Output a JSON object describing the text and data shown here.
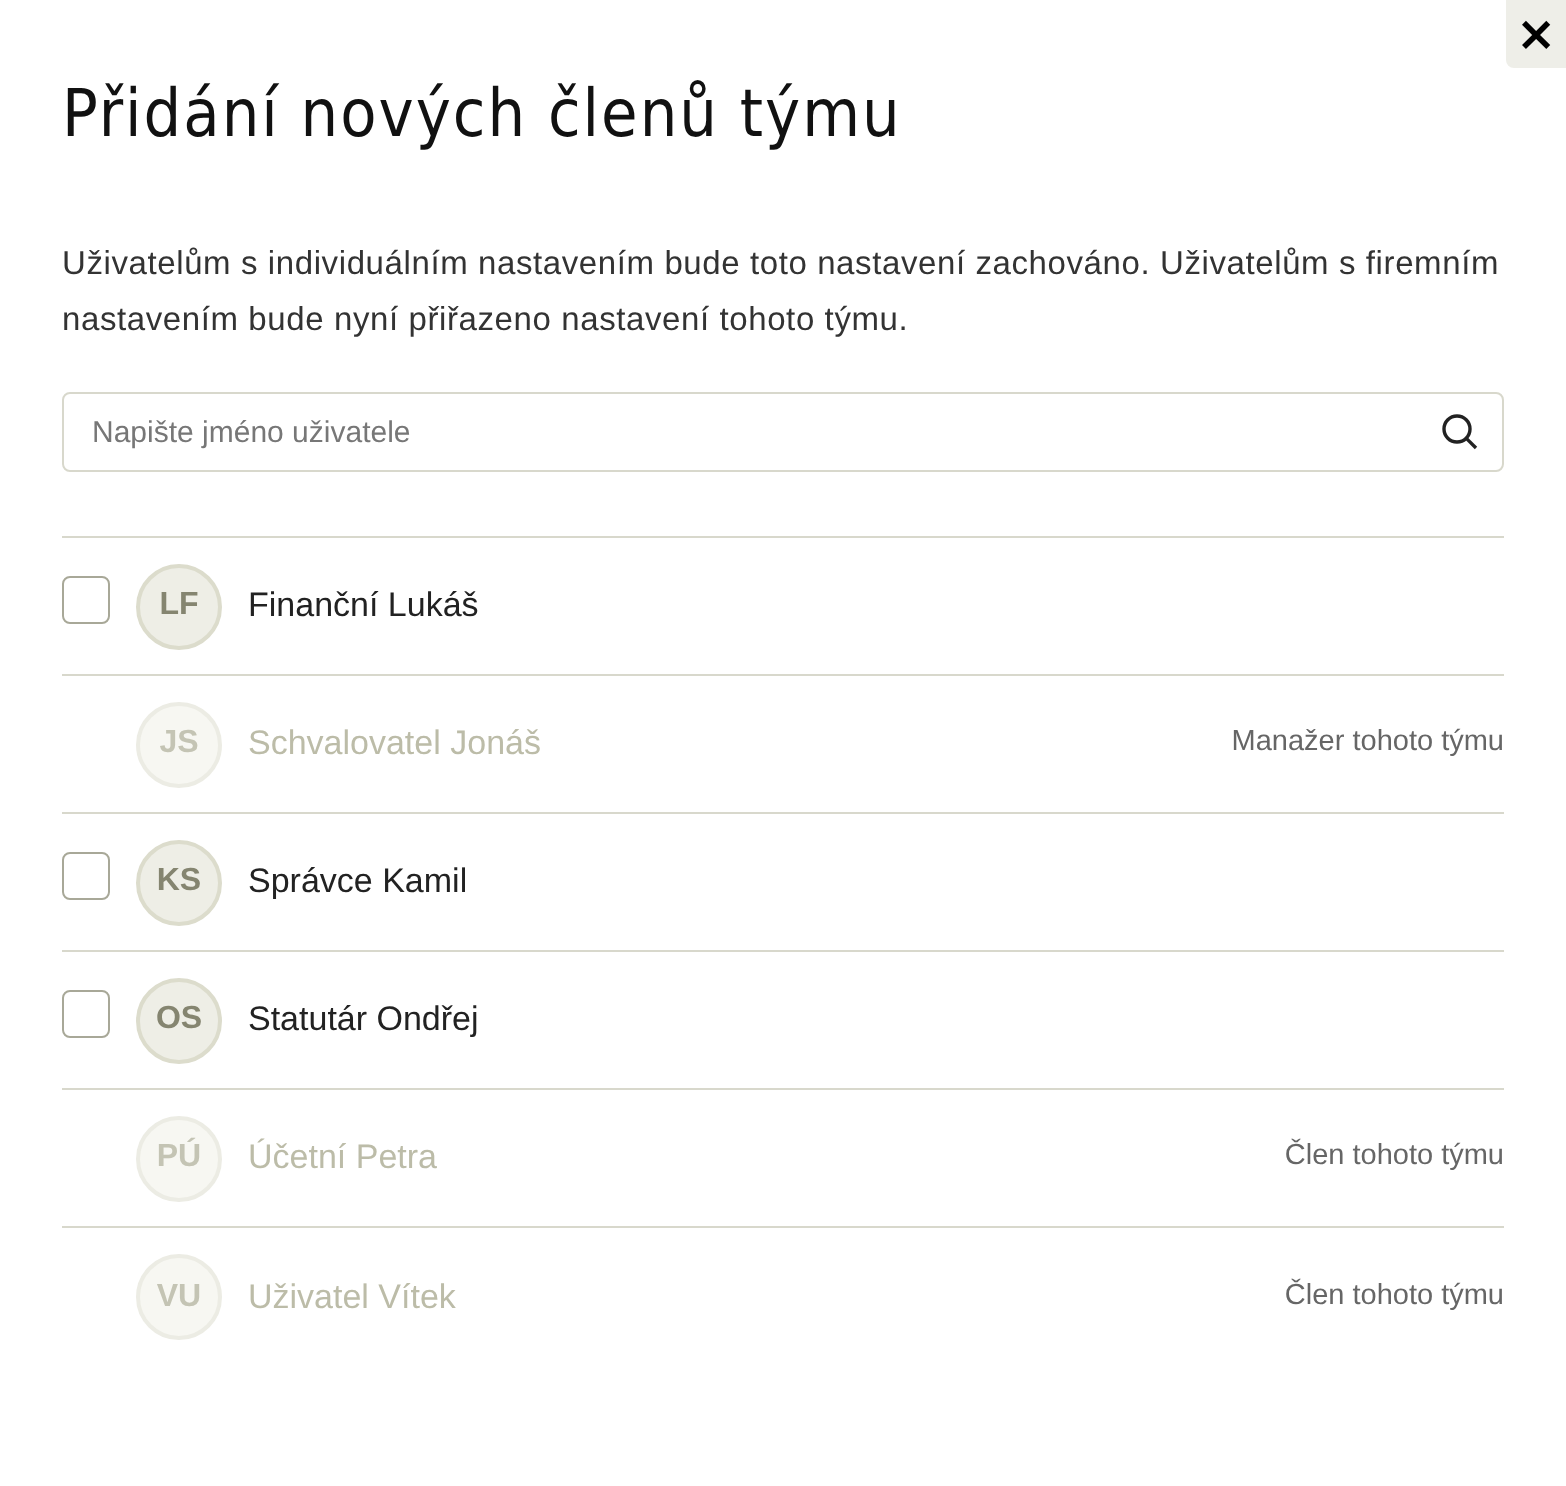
{
  "dialog": {
    "title": "Přidání nových členů týmu",
    "description": "Uživatelům s individuálním nastavením bude toto nastavení zachováno. Uživatelům s firemním nastavením bude nyní přiřazeno nastavení tohoto týmu.",
    "close": "×"
  },
  "search": {
    "placeholder": "Napište jméno uživatele"
  },
  "users": [
    {
      "kind": "selectable",
      "checked": false,
      "initials": "LF",
      "name": "Finanční Lukáš"
    },
    {
      "kind": "member",
      "initials": "JS",
      "name": "Schvalovatel Jonáš",
      "note": "Manažer tohoto týmu"
    },
    {
      "kind": "selectable",
      "checked": false,
      "initials": "KS",
      "name": "Správce Kamil"
    },
    {
      "kind": "selectable",
      "checked": false,
      "initials": "OS",
      "name": "Statutár Ondřej"
    },
    {
      "kind": "member",
      "initials": "PÚ",
      "name": "Účetní Petra",
      "note": "Člen tohoto týmu"
    },
    {
      "kind": "member",
      "initials": "VU",
      "name": "Uživatel Vítek",
      "note": "Člen tohoto týmu"
    }
  ]
}
